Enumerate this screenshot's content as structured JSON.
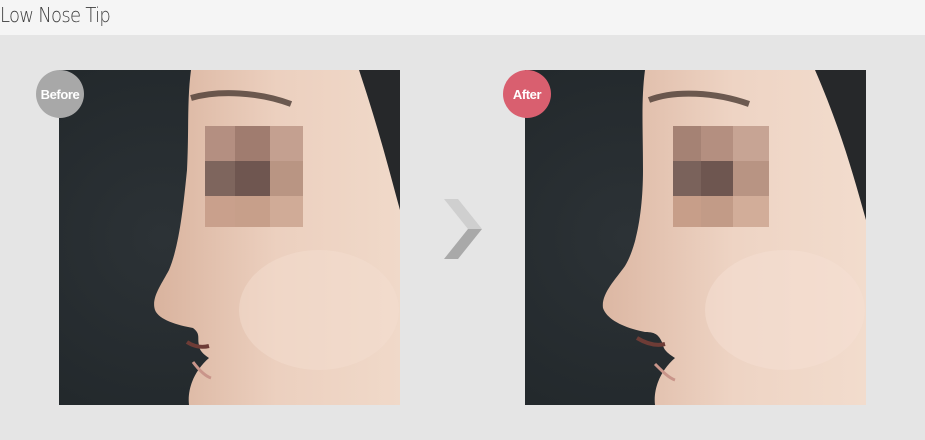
{
  "header": {
    "title": "Low Nose Tip"
  },
  "comparison": {
    "before": {
      "badge_label": "Before",
      "badge_color": "#a8a8a8",
      "image": "profile-photo-low-nose-tip-before"
    },
    "after": {
      "badge_label": "After",
      "badge_color": "#d95f6f",
      "image": "profile-photo-low-nose-tip-after"
    },
    "divider_icon": "chevron-right-icon"
  }
}
